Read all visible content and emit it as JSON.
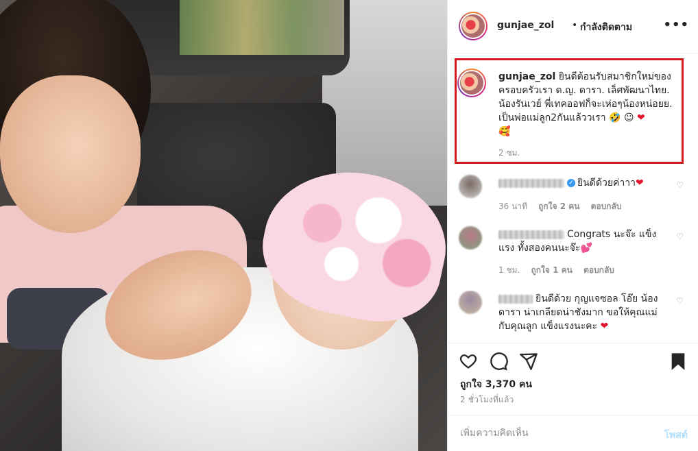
{
  "post": {
    "username": "gunjae_zol",
    "separator": "•",
    "follow_status": "กำลังติดตาม",
    "more_icon": "more-horizontal-icon"
  },
  "caption": {
    "username": "gunjae_zol",
    "text": "ยินดีต้อนรับสมาชิกใหม่ของครอบครัวเรา ด.ญ. ดารา. เล็ศพัฒนาไทย. น้องรันเวย์ พี่เทคออฟก็จะเห่อๆน้องหน่อยย. เป็นพ่อแม่ลูก2กันแล้ววเรา 🤣 ☺ ",
    "emoji_heart": "❤",
    "emoji_end": "🥰",
    "time": "2 ชม."
  },
  "comments": [
    {
      "text": "ยินดีด้วยค่าาา",
      "verified": true,
      "emoji": "❤",
      "time": "36 นาที",
      "likes": "ถูกใจ 2 คน",
      "reply": "ตอบกลับ"
    },
    {
      "text": "Congrats นะจ๊ะ แข็งแรง ทั้งสองคนนะจ๊ะ",
      "verified": false,
      "emoji": "💕",
      "time": "1 ชม.",
      "likes": "ถูกใจ 1 คน",
      "reply": "ตอบกลับ"
    },
    {
      "text": "ยินดีด้วย กุญแจซอล โอ๊ย น้อง ดารา น่าเกลียดน่าชังมาก ขอให้คุณแม่ กับคุณลูก แข็งแรงนะคะ",
      "verified": false,
      "emoji": "❤",
      "time": "",
      "likes": "",
      "reply": ""
    }
  ],
  "actions": {
    "likes": "ถูกใจ 3,370 คน",
    "time_ago": "2 ชั่วโมงที่แล้ว",
    "icons": [
      "heart-icon",
      "comment-icon",
      "share-icon",
      "bookmark-icon"
    ]
  },
  "composer": {
    "placeholder": "เพิ่มความคิดเห็น",
    "post_label": "โพสต์"
  }
}
